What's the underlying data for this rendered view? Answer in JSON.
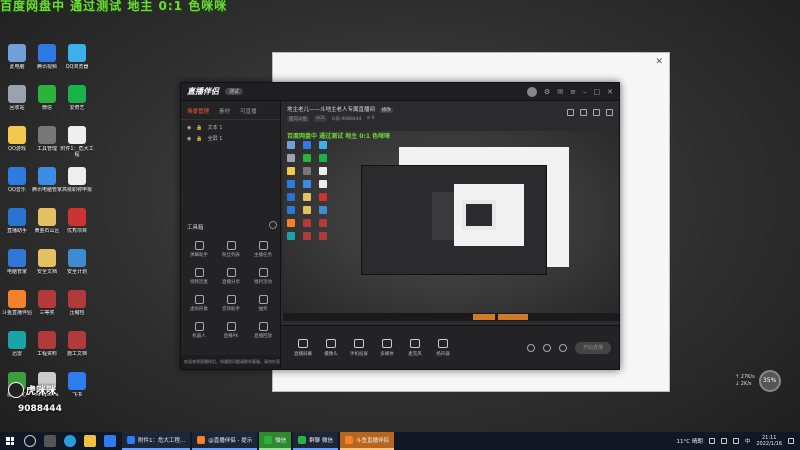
{
  "banner": "百度网盘中 通过测试 地主 0:1 色咪咪",
  "desktop_icons": [
    {
      "label": "此电脑",
      "color": "#6fa0d8"
    },
    {
      "label": "腾讯视频",
      "color": "#2c7be5"
    },
    {
      "label": "QQ浏览器",
      "color": "#3ab1e8"
    },
    {
      "label": "回收站",
      "color": "#9aa3ad"
    },
    {
      "label": "微信",
      "color": "#2bb33b"
    },
    {
      "label": "爱奇艺",
      "color": "#19b34a"
    },
    {
      "label": "QQ游戏",
      "color": "#f2c94c"
    },
    {
      "label": "工具管理",
      "color": "#777"
    },
    {
      "label": "附件1：危大工程",
      "color": "#eee"
    },
    {
      "label": "QQ音乐",
      "color": "#2d7be0"
    },
    {
      "label": "腾讯电脑管家",
      "color": "#3c8ce6"
    },
    {
      "label": "高级职称申报",
      "color": "#eee"
    },
    {
      "label": "直播助手",
      "color": "#2a72d0"
    },
    {
      "label": "黄金石山区",
      "color": "#e3c060"
    },
    {
      "label": "优秀项目",
      "color": "#c33"
    },
    {
      "label": "电脑管家",
      "color": "#3077d8"
    },
    {
      "label": "安全文档",
      "color": "#e3c060"
    },
    {
      "label": "安全计划",
      "color": "#3b8cd0"
    },
    {
      "label": "斗鱼直播伴侣",
      "color": "#f5822a"
    },
    {
      "label": "三等奖",
      "color": "#b23a3a"
    },
    {
      "label": "压缩包",
      "color": "#b23a3a"
    },
    {
      "label": "迅雷",
      "color": "#1aa4a8"
    },
    {
      "label": "工程资料",
      "color": "#b23a3a"
    },
    {
      "label": "施工文档",
      "color": "#b23a3a"
    },
    {
      "label": "游戏中心",
      "color": "#3b9e3b"
    },
    {
      "label": "APaperFa",
      "color": "#ccc"
    },
    {
      "label": "飞书",
      "color": "#2f7bf0"
    }
  ],
  "white_window": {
    "close": "✕"
  },
  "app": {
    "logo": "直播伴侣",
    "badge": "测试",
    "tabs": [
      "场景管理",
      "素材",
      "可直播"
    ],
    "scenes": [
      "文本 1",
      "全屏 1"
    ],
    "tools_title": "工具箱",
    "tools": [
      "弹幕助手",
      "粉丝列表",
      "主播任务",
      "视频连麦",
      "直播分享",
      "福利活动",
      "虚拟形象",
      "音效助手",
      "抽奖",
      "机器人",
      "直播PK",
      "直播回放"
    ],
    "notice": "欢迎来到直播伴侣，如遇到问题请联系客服，请勿在直播中发布违规内容",
    "stream_title": "地主老儿——斗地主老人专属直播间",
    "stream_tag": "修改",
    "stream_meta": [
      "面向斗鱼",
      "SCE",
      "Q号:9088444",
      "⊙ 0"
    ],
    "preview_banner": "百度网盘中 通过测试 地主 0:1 色咪咪",
    "bottom_buttons": [
      "直播屏幕",
      "摄像头",
      "手机投屏",
      "多媒体",
      "麦克风",
      "扬声器"
    ],
    "start_live": "开始直播"
  },
  "profile": {
    "name": "虎咪咪",
    "id": "9088444"
  },
  "net": {
    "up": "↑ 27K/s",
    "down": "↓ 2K/s",
    "percent": "35%"
  },
  "taskbar": {
    "tasks": [
      {
        "label": "附件1：危大工程...",
        "style": "blue",
        "color": "#2f7bf0"
      },
      {
        "label": "@直播伴侣 - 提示",
        "style": "blue",
        "color": "#f5822a"
      },
      {
        "label": "微信",
        "style": "green",
        "color": "#2bb33b"
      },
      {
        "label": "群聊 微信",
        "style": "blue",
        "color": "#2bb33b"
      },
      {
        "label": "斗鱼直播伴侣",
        "style": "orange",
        "color": "#f5822a"
      }
    ],
    "weather": "11°C 晴朗",
    "lang": "中",
    "time": "21:11",
    "date": "2022/1/16"
  }
}
